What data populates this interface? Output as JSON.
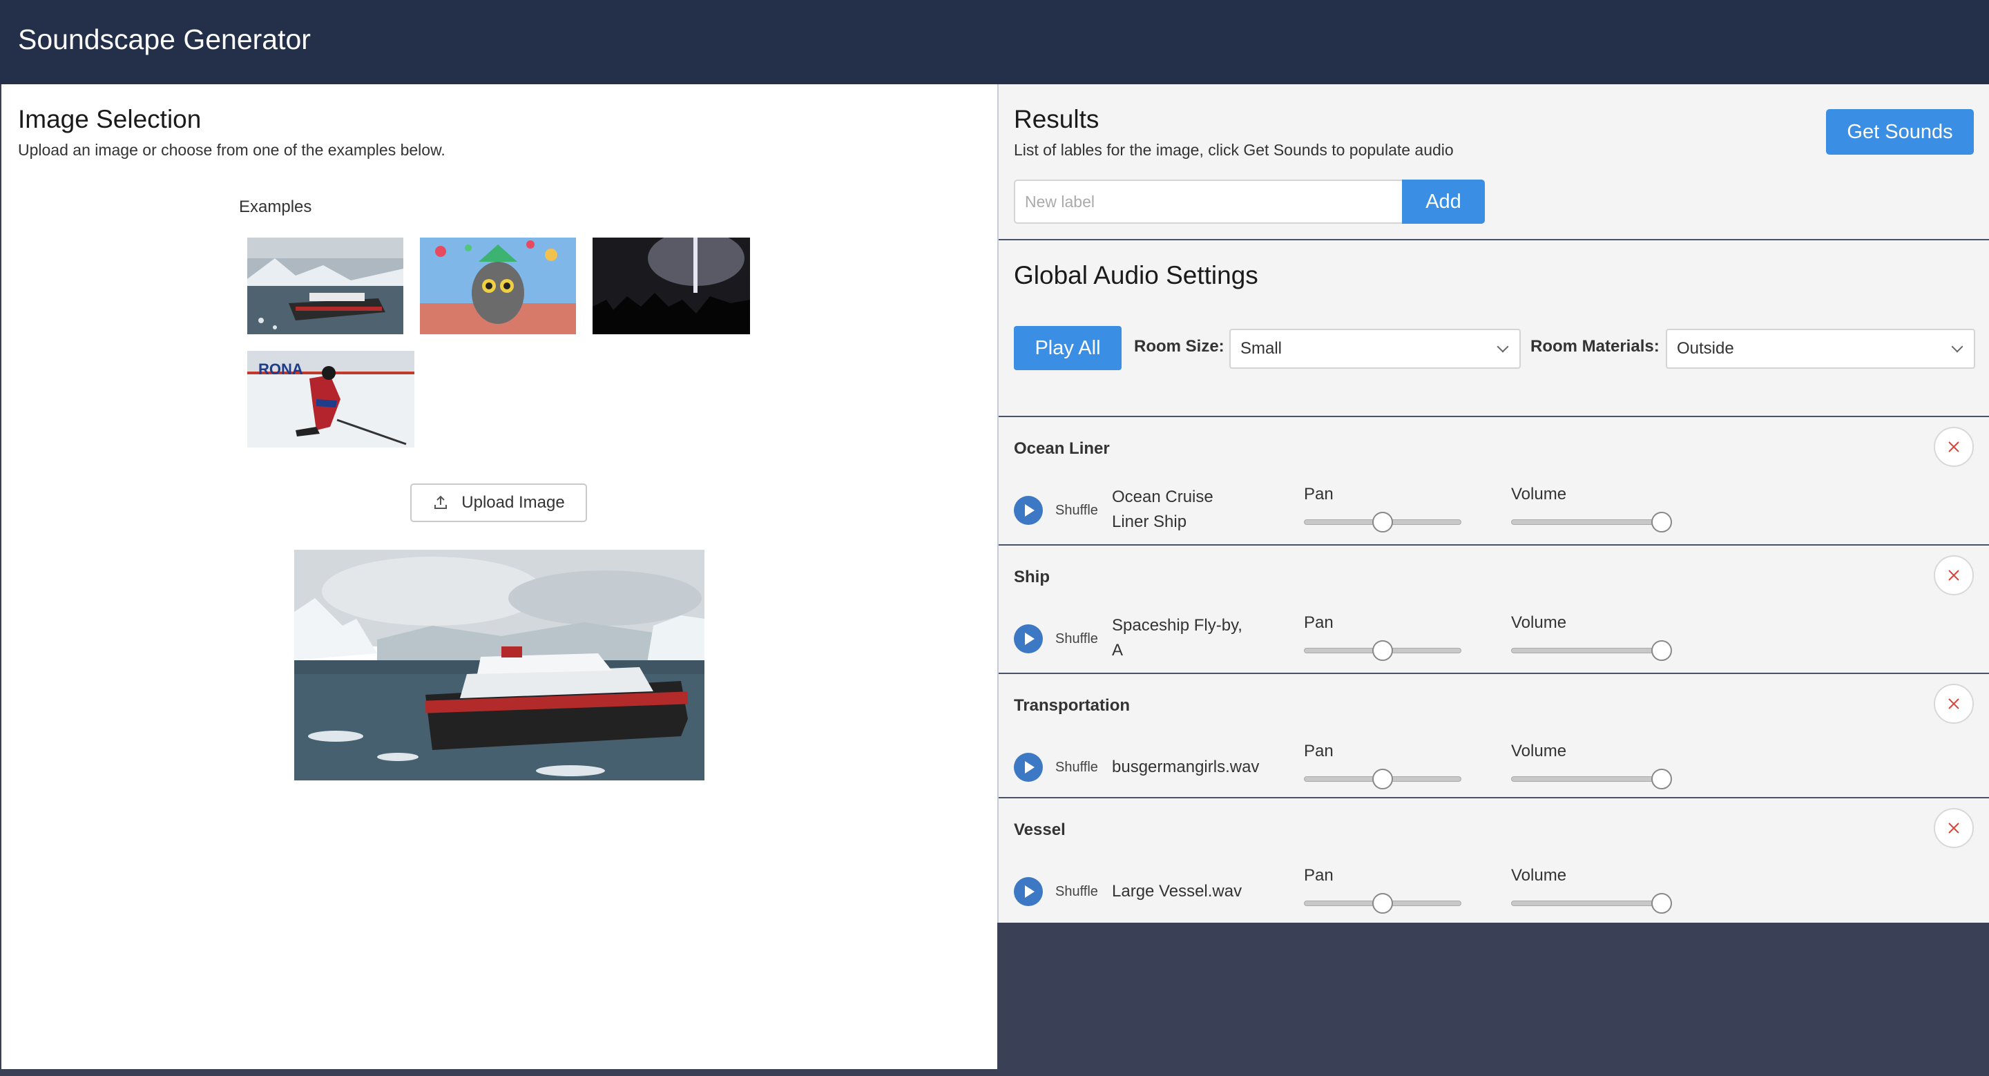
{
  "app": {
    "title": "Soundscape Generator"
  },
  "image_selection": {
    "title": "Image Selection",
    "subtitle": "Upload an image or choose from one of the examples below.",
    "examples_label": "Examples",
    "examples": [
      {
        "name": "cruise-ship",
        "overlay_text": ""
      },
      {
        "name": "party-lemur",
        "overlay_text": ""
      },
      {
        "name": "concert",
        "overlay_text": ""
      },
      {
        "name": "hockey-player",
        "overlay_text": "RONA"
      }
    ],
    "upload_button": "Upload Image"
  },
  "results": {
    "title": "Results",
    "subtitle": "List of lables for the image, click Get Sounds to populate audio",
    "get_sounds_button": "Get Sounds",
    "label_input": {
      "placeholder": "New label",
      "value": ""
    },
    "add_button": "Add"
  },
  "global_audio": {
    "title": "Global Audio Settings",
    "play_all_button": "Play All",
    "room_size_label": "Room Size:",
    "room_size_value": "Small",
    "room_materials_label": "Room Materials:",
    "room_materials_value": "Outside"
  },
  "sound_groups": [
    {
      "label": "Ocean Liner",
      "shuffle": "Shuffle",
      "sound": "Ocean Cruise Liner Ship",
      "pan_label": "Pan",
      "volume_label": "Volume",
      "pan": 0.5,
      "volume": 1.0
    },
    {
      "label": "Ship",
      "shuffle": "Shuffle",
      "sound": "Spaceship Fly-by, A",
      "pan_label": "Pan",
      "volume_label": "Volume",
      "pan": 0.5,
      "volume": 1.0
    },
    {
      "label": "Transportation",
      "shuffle": "Shuffle",
      "sound": "busgermangirls.wav",
      "pan_label": "Pan",
      "volume_label": "Volume",
      "pan": 0.5,
      "volume": 1.0
    },
    {
      "label": "Vessel",
      "shuffle": "Shuffle",
      "sound": "Large Vessel.wav",
      "pan_label": "Pan",
      "volume_label": "Volume",
      "pan": 0.5,
      "volume": 1.0
    }
  ],
  "icons": {
    "upload": "upload-icon",
    "play": "play-icon",
    "remove": "close-icon",
    "chevron": "chevron-down-icon"
  },
  "colors": {
    "appbar": "#243049",
    "accent": "#3a8ee3",
    "play_circle": "#3d78c4",
    "remove_x": "#d9453a"
  }
}
